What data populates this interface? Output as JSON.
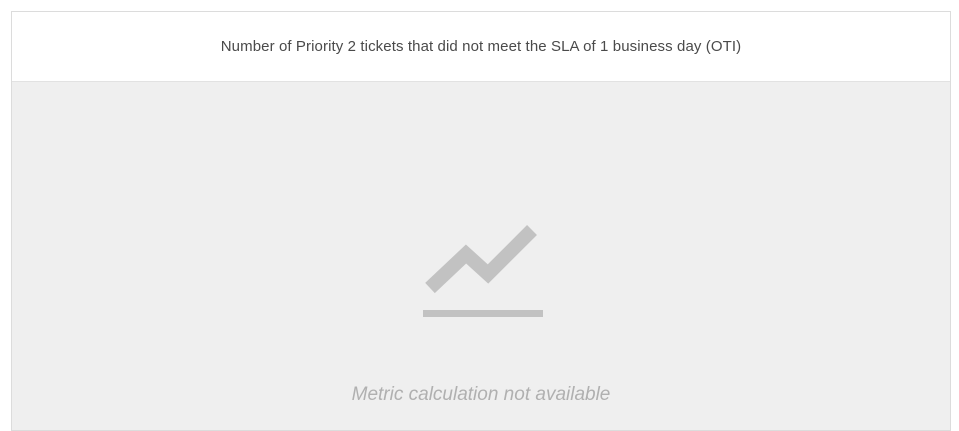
{
  "widget": {
    "title": "Number of Priority 2 tickets that did not meet the SLA of 1 business day (OTI)",
    "icon": "line-chart-icon",
    "empty_message": "Metric calculation not available"
  },
  "colors": {
    "background": "#ffffff",
    "body_background": "#efefef",
    "border": "#dcdcdc",
    "icon": "#c2c2c2",
    "title_text": "#4a4a4a",
    "message_text": "#b0b0b0"
  }
}
